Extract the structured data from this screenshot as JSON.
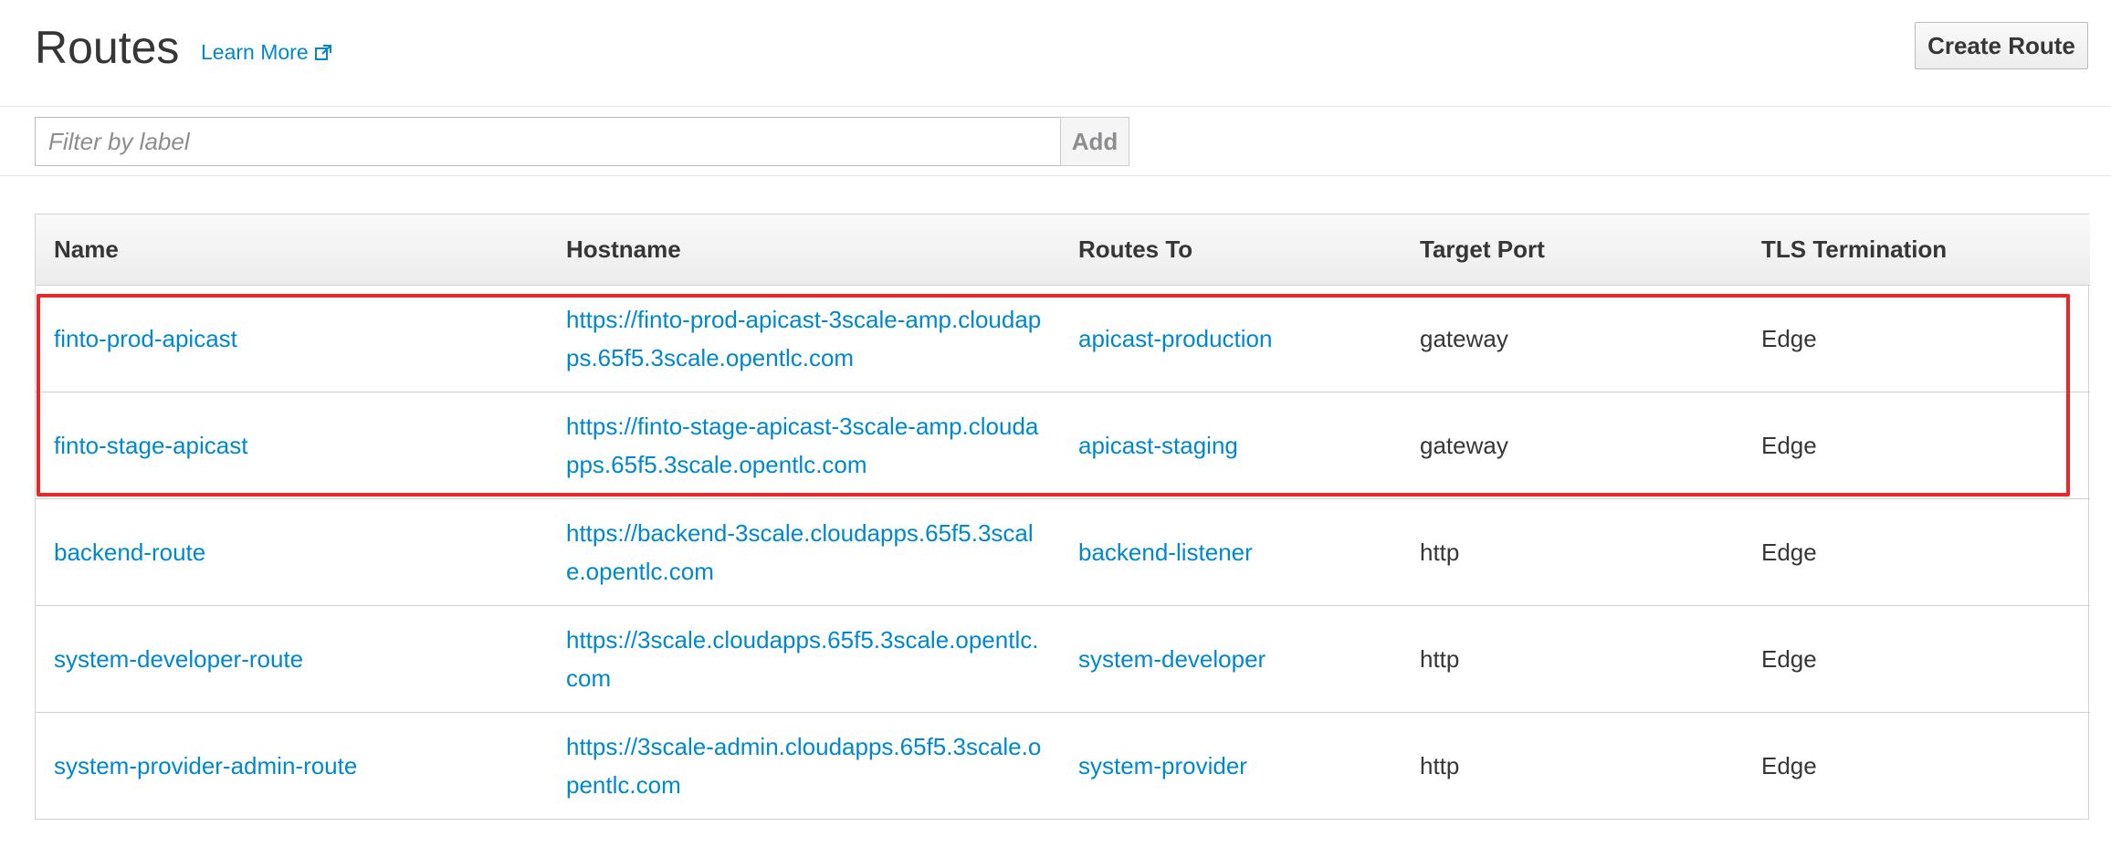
{
  "header": {
    "title": "Routes",
    "learn_more": "Learn More",
    "learn_more_icon": "external-link-icon",
    "create_button": "Create Route"
  },
  "toolbar": {
    "filter_placeholder": "Filter by label",
    "filter_value": "",
    "add_button": "Add"
  },
  "table": {
    "columns": [
      "Name",
      "Hostname",
      "Routes To",
      "Target Port",
      "TLS Termination"
    ],
    "rows": [
      {
        "name": "finto-prod-apicast",
        "hostname": "https://finto-prod-apicast-3scale-amp.cloudapps.65f5.3scale.opentlc.com",
        "routes_to": "apicast-production",
        "target_port": "gateway",
        "tls": "Edge"
      },
      {
        "name": "finto-stage-apicast",
        "hostname": "https://finto-stage-apicast-3scale-amp.cloudapps.65f5.3scale.opentlc.com",
        "routes_to": "apicast-staging",
        "target_port": "gateway",
        "tls": "Edge"
      },
      {
        "name": "backend-route",
        "hostname": "https://backend-3scale.cloudapps.65f5.3scale.opentlc.com",
        "routes_to": "backend-listener",
        "target_port": "http",
        "tls": "Edge"
      },
      {
        "name": "system-developer-route",
        "hostname": "https://3scale.cloudapps.65f5.3scale.opentlc.com",
        "routes_to": "system-developer",
        "target_port": "http",
        "tls": "Edge"
      },
      {
        "name": "system-provider-admin-route",
        "hostname": "https://3scale-admin.cloudapps.65f5.3scale.opentlc.com",
        "routes_to": "system-provider",
        "target_port": "http",
        "tls": "Edge"
      }
    ]
  },
  "colors": {
    "link": "#0088ce",
    "highlight": "#e8282b",
    "text": "#363636"
  }
}
